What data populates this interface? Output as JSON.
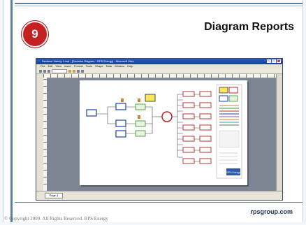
{
  "slide": {
    "badge_number": "9",
    "title": "Diagram Reports",
    "footer_brand": "rpsgroup.com",
    "copyright": "© Copyright 2009.  All Rights Reserved.  RPS Energy"
  },
  "window": {
    "title": "Decision Variety 1.vsd - [Decision Diagram - RPS Energy] - Microsoft Visio",
    "menu": [
      "File",
      "Edit",
      "View",
      "Insert",
      "Format",
      "Tools",
      "Shape",
      "Data",
      "Window",
      "Help"
    ],
    "page_tab": "Page-1"
  },
  "diagram": {
    "logo_text": "RPS Energy"
  },
  "colors": {
    "badge": "#c42122",
    "accent": "#5a7fa6",
    "visio_titlebar": "#2a58b8"
  }
}
